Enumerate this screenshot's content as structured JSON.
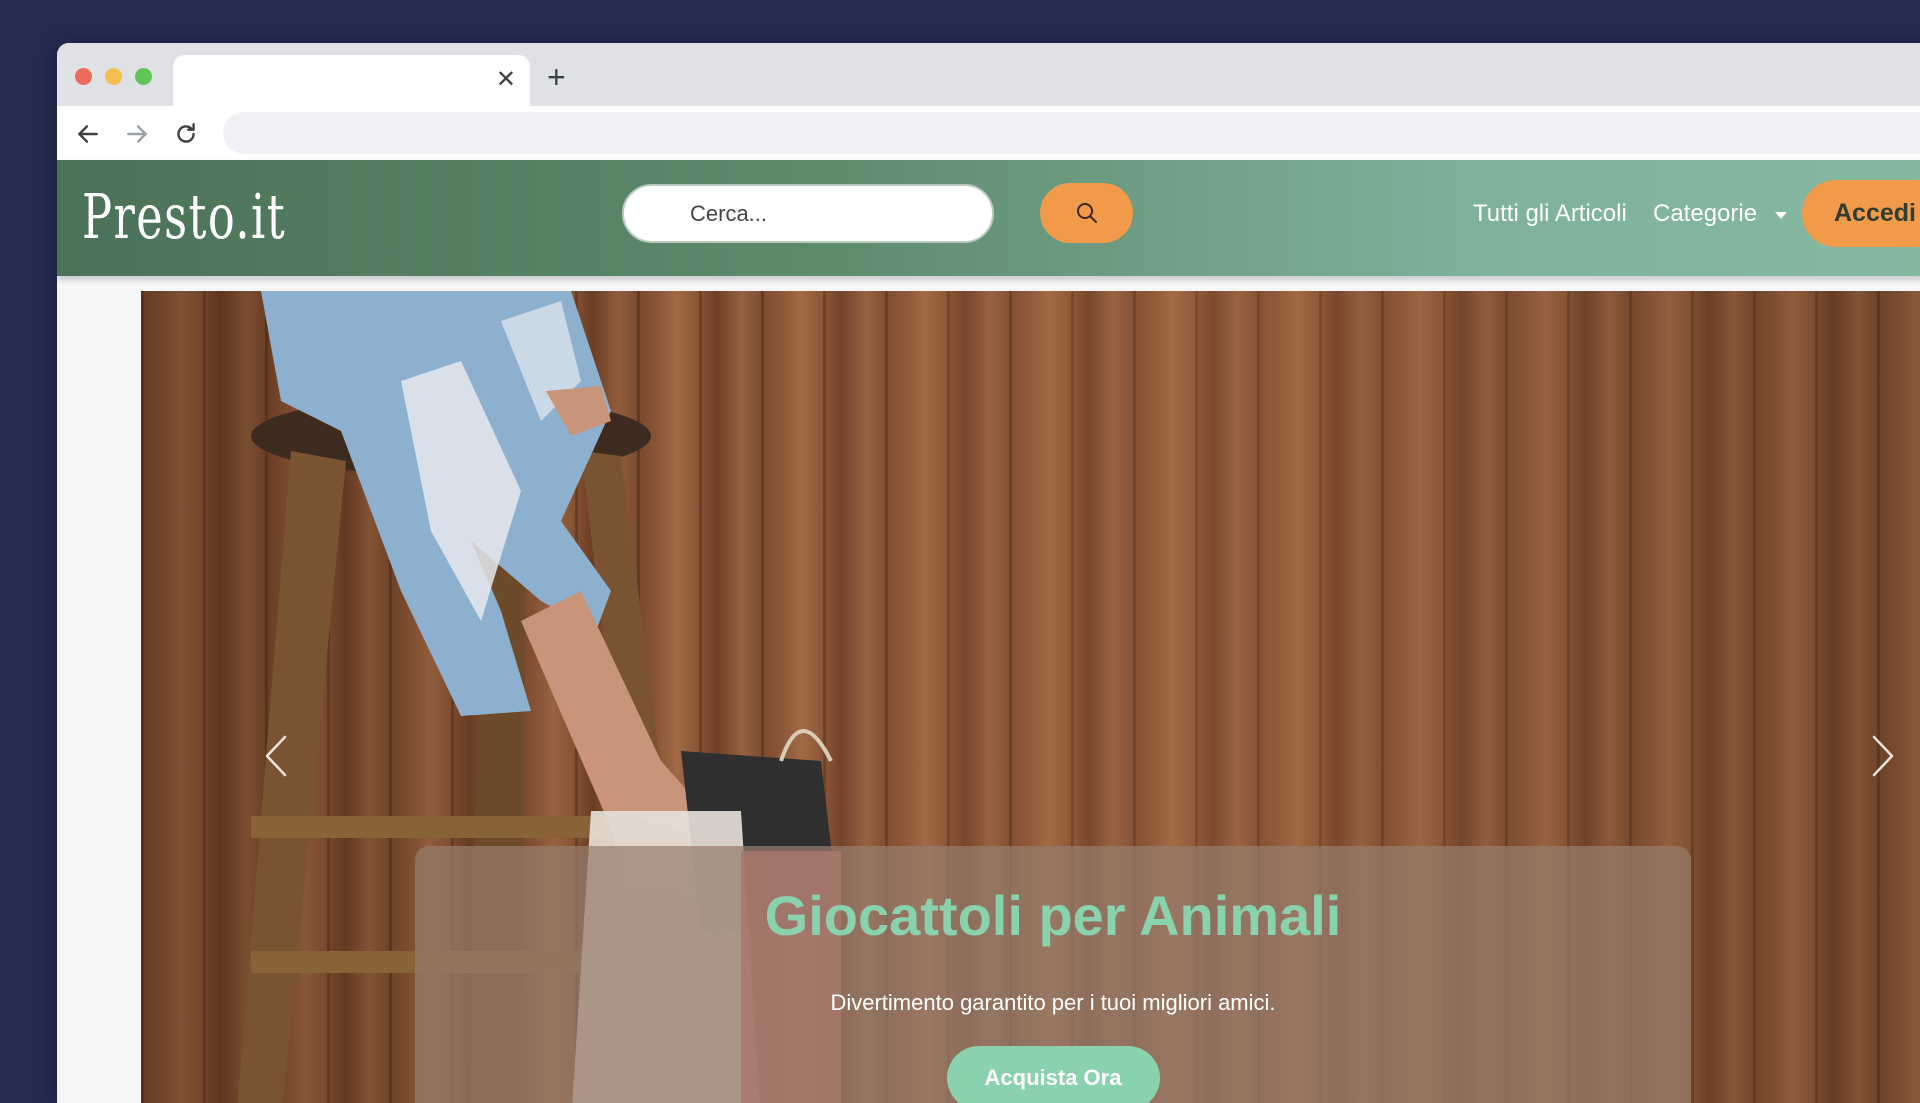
{
  "browser": {
    "tab_title": "",
    "tab_close": "✕",
    "new_tab": "+",
    "url": ""
  },
  "site": {
    "logo": "Presto.it",
    "search": {
      "placeholder": "Cerca..."
    },
    "nav": {
      "all_articles": "Tutti gli Articoli",
      "categories": "Categorie",
      "login": "Accedi"
    }
  },
  "hero": {
    "title": "Giocattoli per Animali",
    "subtitle": "Divertimento garantito per i tuoi migliori amici.",
    "cta": "Acquista Ora"
  },
  "colors": {
    "accent_orange": "#f09a4a",
    "accent_mint": "#8ad1ad",
    "nav_green": "#5f8a6c",
    "desktop_bg": "#252c52"
  },
  "icons": {
    "back": "arrow-left-icon",
    "forward": "arrow-right-icon",
    "reload": "reload-icon",
    "search": "search-icon",
    "prev": "chevron-left-icon",
    "next": "chevron-right-icon"
  }
}
